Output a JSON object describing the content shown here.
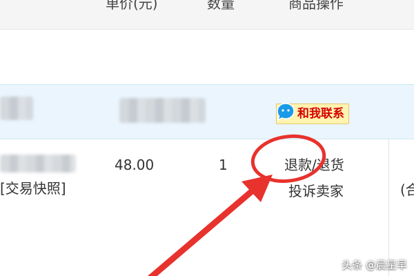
{
  "table": {
    "headers": {
      "unit_price": "单价(元)",
      "quantity": "数量",
      "operations": "商品操作"
    }
  },
  "shop": {
    "contact_label": "和我联系"
  },
  "item": {
    "snapshot_label": "[交易快照]",
    "unit_price": "48.00",
    "quantity": "1",
    "actions": {
      "refund": "退款/退货",
      "complain": "投诉卖家"
    },
    "next_column_fragment": "(合"
  },
  "watermark": "头条 @晨星早",
  "colors": {
    "header_bg": "#f5f5f5",
    "shop_band_bg": "#eaf5fd",
    "badge_bg": "#fff3b0",
    "badge_text": "#d40000",
    "annotation_red": "#e8322d"
  }
}
